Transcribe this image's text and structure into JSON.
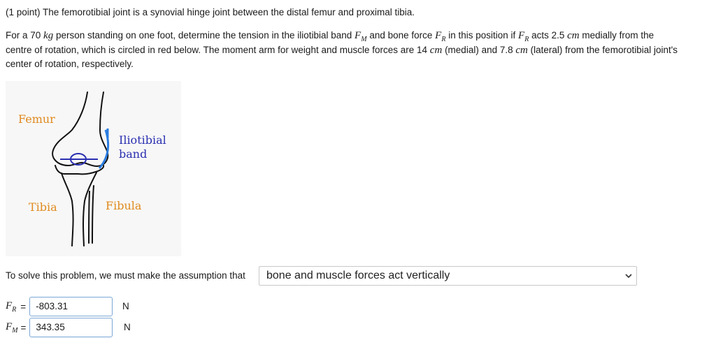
{
  "problem": {
    "header": "(1 point) The femorotibial joint is a synovial hinge joint between the distal femur and proximal tibia.",
    "line1_a": "For a 70",
    "mass_unit": "kg",
    "line1_b": "person standing on one foot, determine the tension in the iliotibial band",
    "fm_symbol": "F",
    "fm_sub": "M",
    "line1_c": "and bone force",
    "fr_symbol": "F",
    "fr_sub": "R",
    "line1_d": "in this position if",
    "line1_e": "acts 2.5",
    "cm_unit": "cm",
    "line1_f": "medially from the",
    "line2_a": "centre of rotation, which is circled in red below. The moment arm for weight and muscle forces are 14",
    "line2_b": "(medial) and 7.8",
    "line2_c": "(lateral) from the femorotibial joint's",
    "line3": "center of rotation, respectively."
  },
  "figure": {
    "femur_label": "Femur",
    "iliotibial_label_1": "Iliotibial",
    "iliotibial_label_2": "band",
    "tibia_label": "Tibia",
    "fibula_label": "Fibula",
    "colors": {
      "femur": "#e08a1e",
      "iliotibial": "#2a2fb0",
      "tibia": "#e08a1e",
      "fibula": "#e08a1e",
      "band": "#2b7de0",
      "joint_circle": "#2a2fb0"
    }
  },
  "assumption": {
    "prompt": "To solve this problem, we must make the assumption that",
    "selected": "bone and muscle forces act vertically"
  },
  "answers": {
    "fr_symbol": "F",
    "fr_sub": "R",
    "fr_eq": "=",
    "fr_value": "-803.31",
    "fr_unit": "N",
    "fm_symbol": "F",
    "fm_sub": "M",
    "fm_eq": "=",
    "fm_value": "343.35",
    "fm_unit": "N"
  }
}
